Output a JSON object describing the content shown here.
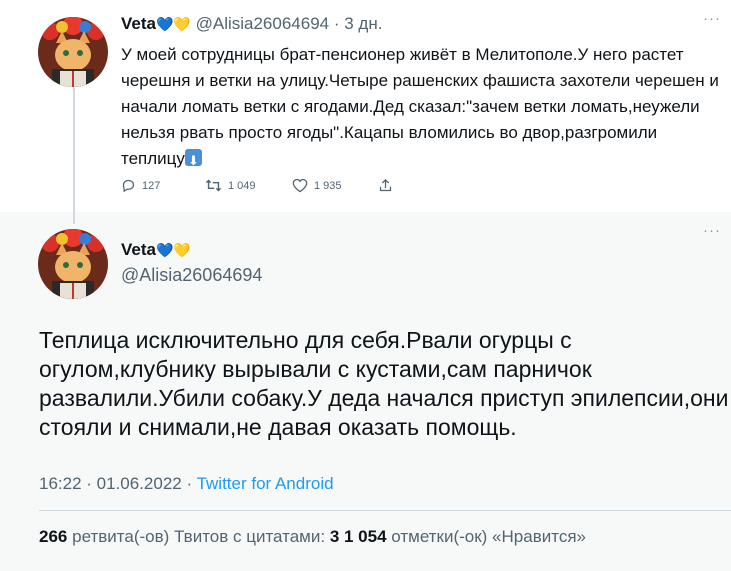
{
  "tweet1": {
    "name": "Veta",
    "hearts": "💙💛",
    "handle": "@Alisia26064694",
    "time": "3 дн.",
    "text_before_icon": "У моей сотрудницы брат-пенсионер живёт в Мелитополе.У него растет черешня и ветки на улицу.Четыре рашенских фашиста захотели черешен и начали ломать ветки с ягодами.Дед сказал:\"зачем ветки ломать,неужели нельзя рвать просто ягоды\".Кацапы вломились во двор,разгромили теплицу",
    "text_icon": "down-arrow-emoji",
    "actions": {
      "replies": "127",
      "retweets": "1 049",
      "likes": "1 935"
    }
  },
  "tweet2": {
    "name": "Veta",
    "hearts": "💙💛",
    "handle": "@Alisia26064694",
    "text": "Теплица исключительно для себя.Рвали огурцы с огулом,клубнику вырывали с кустами,сам парничок развалили.Убили собаку.У деда начался приступ эпилепсии,они стояли и снимали,не давая оказать помощь.",
    "time": "16:22",
    "date": "01.06.2022",
    "source": "Twitter for Android",
    "stats": {
      "retweets_count": "266",
      "retweets_label": "ретвита(-ов)",
      "quotes_label": "Твитов с цитатами:",
      "likes_count": "3 1 054",
      "likes_label": "отметки(-ок) «Нравится»"
    }
  },
  "colors": {
    "accent": "#1d9bf0",
    "secondary_text": "#536471",
    "focused_bg": "#f7f9f9"
  }
}
